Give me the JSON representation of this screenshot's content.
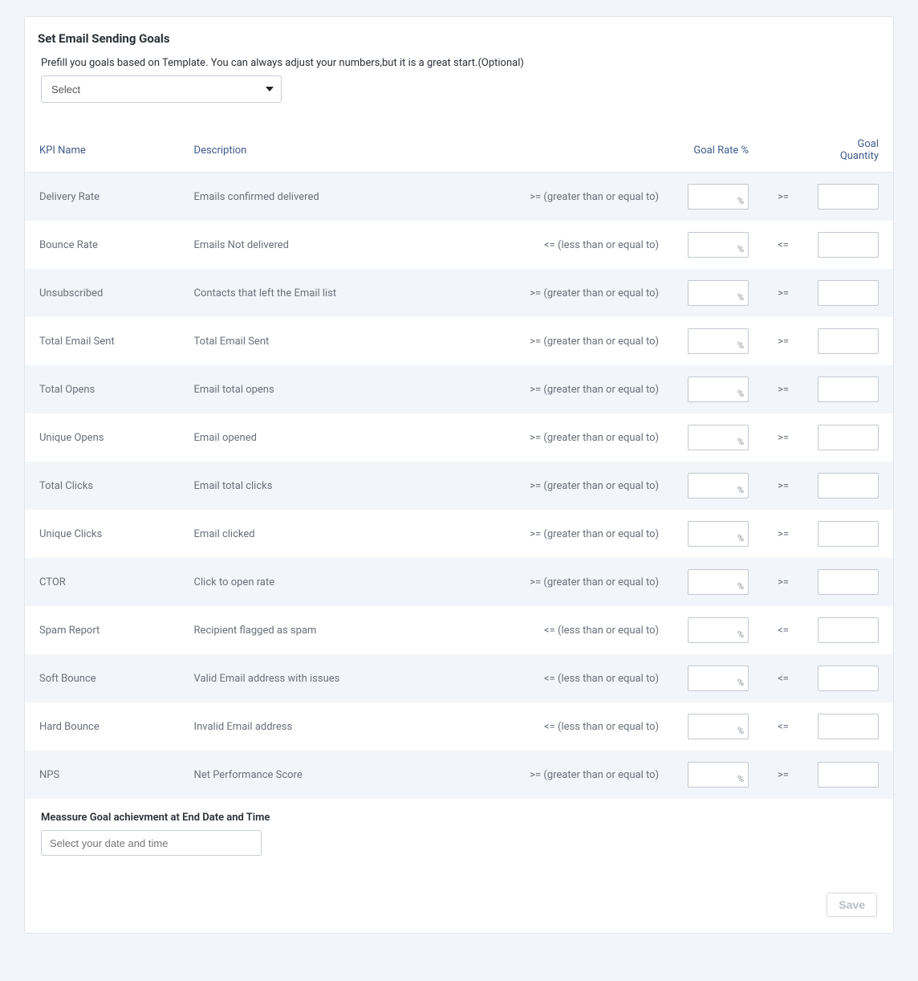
{
  "card": {
    "title": "Set Email Sending Goals",
    "prefill_text": "Prefill you goals based on Template. You can always adjust your numbers,but it is a great start.(Optional)",
    "template_select": "Select"
  },
  "headers": {
    "kpi_name": "KPI Name",
    "description": "Description",
    "goal_rate": "Goal Rate %",
    "goal_qty": "Goal Quantity"
  },
  "operators": {
    "ge_long": ">= (greater than or equal to)",
    "le_long": "<= (less than or equal to)",
    "ge_short": ">=",
    "le_short": "<="
  },
  "percent_sign": "%",
  "rows": [
    {
      "name": "Delivery Rate",
      "desc": "Emails confirmed delivered",
      "op": "ge"
    },
    {
      "name": "Bounce Rate",
      "desc": "Emails Not delivered",
      "op": "le"
    },
    {
      "name": "Unsubscribed",
      "desc": "Contacts that left the Email list",
      "op": "ge"
    },
    {
      "name": "Total Email Sent",
      "desc": "Total Email Sent",
      "op": "ge"
    },
    {
      "name": "Total Opens",
      "desc": "Email total opens",
      "op": "ge"
    },
    {
      "name": "Unique Opens",
      "desc": "Email opened",
      "op": "ge"
    },
    {
      "name": "Total Clicks",
      "desc": "Email total clicks",
      "op": "ge"
    },
    {
      "name": "Unique Clicks",
      "desc": "Email clicked",
      "op": "ge"
    },
    {
      "name": "CTOR",
      "desc": "Click to open rate",
      "op": "ge"
    },
    {
      "name": "Spam Report",
      "desc": "Recipient flagged as spam",
      "op": "le"
    },
    {
      "name": "Soft Bounce",
      "desc": "Valid Email address with issues",
      "op": "le"
    },
    {
      "name": "Hard Bounce",
      "desc": "Invalid Email address",
      "op": "le"
    },
    {
      "name": "NPS",
      "desc": "Net Performance Score",
      "op": "ge"
    }
  ],
  "measure": {
    "label": "Meassure Goal achievment at End Date and Time",
    "placeholder": "Select your date and time"
  },
  "buttons": {
    "save": "Save"
  }
}
